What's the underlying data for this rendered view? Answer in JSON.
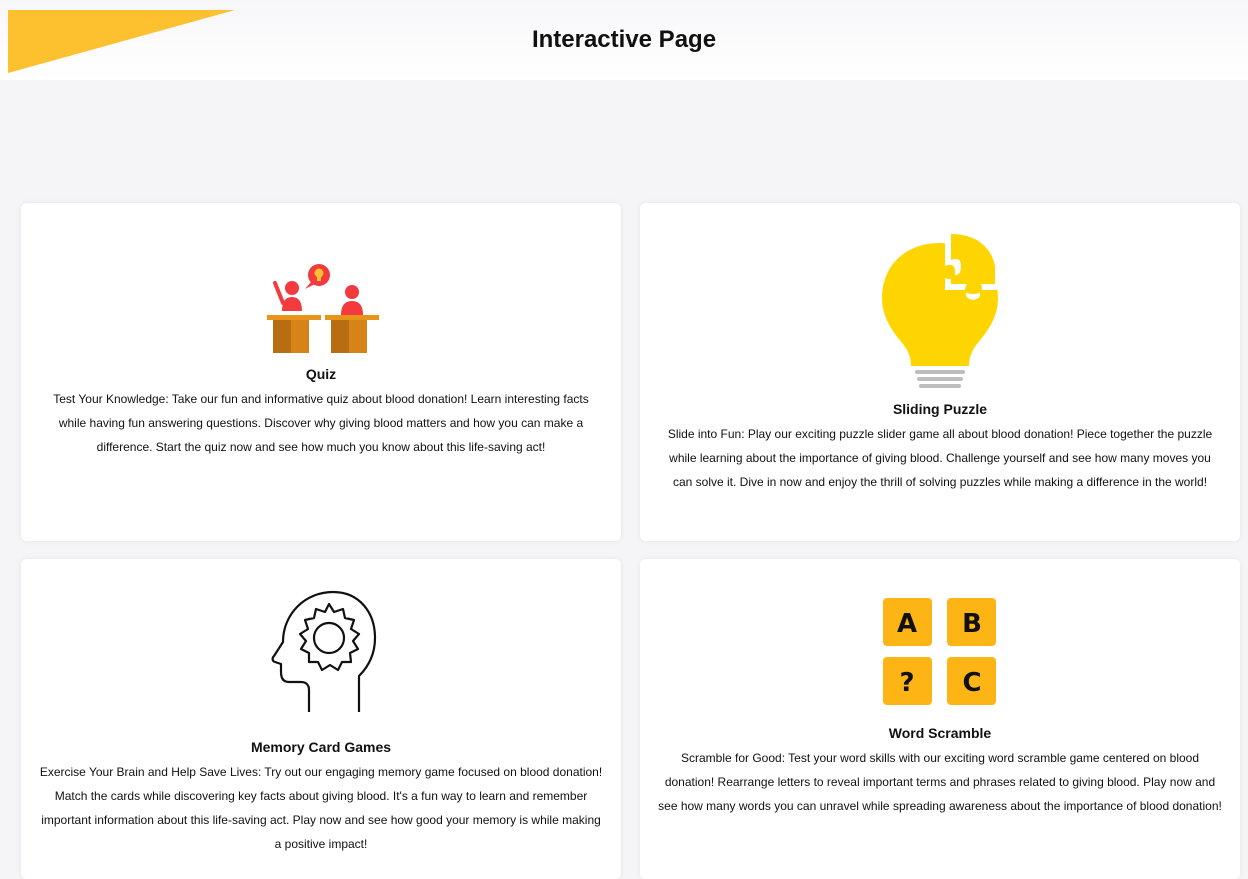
{
  "header": {
    "title": "Interactive Page",
    "accent_color": "#FDC02F"
  },
  "cards": [
    {
      "title": "Quiz",
      "icon": "classroom-quiz-icon",
      "description": "Test Your Knowledge: Take our fun and informative quiz about blood donation! Learn interesting facts while having fun answering questions. Discover why giving blood matters and how you can make a difference. Start the quiz now and see how much you know about this life-saving act!"
    },
    {
      "title": "Sliding Puzzle",
      "icon": "lightbulb-puzzle-icon",
      "description": "Slide into Fun: Play our exciting puzzle slider game all about blood donation! Piece together the puzzle while learning about the importance of giving blood. Challenge yourself and see how many moves you can solve it. Dive in now and enjoy the thrill of solving puzzles while making a difference in the world!"
    },
    {
      "title": "Memory Card Games",
      "icon": "head-gear-icon",
      "description": "Exercise Your Brain and Help Save Lives: Try out our engaging memory game focused on blood donation! Match the cards while discovering key facts about giving blood. It's a fun way to learn and remember important information about this life-saving act. Play now and see how good your memory is while making a positive impact!"
    },
    {
      "title": "Word Scramble",
      "icon": "letter-tiles-icon",
      "tiles": [
        "A",
        "B",
        "?",
        "C"
      ],
      "description": "Scramble for Good: Test your word skills with our exciting word scramble game centered on blood donation! Rearrange letters to reveal important terms and phrases related to giving blood. Play now and see how many words you can unravel while spreading awareness about the importance of blood donation!"
    }
  ]
}
